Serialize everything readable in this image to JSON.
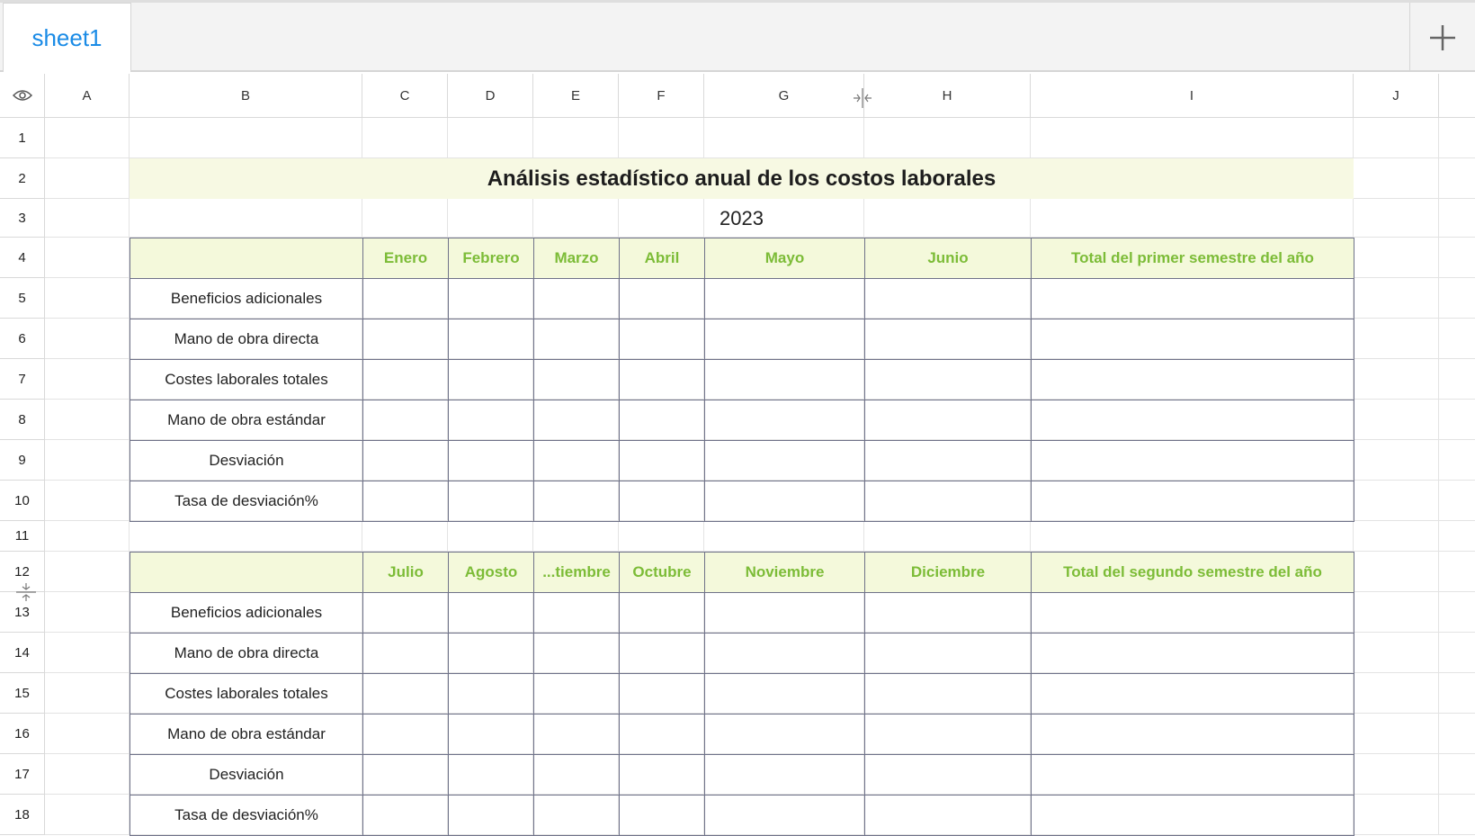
{
  "tabs": [
    {
      "label": "sheet1"
    }
  ],
  "add_tab_icon": "plus-icon",
  "visibility_icon": "eye-icon",
  "columns": [
    "A",
    "B",
    "C",
    "D",
    "E",
    "F",
    "G",
    "H",
    "I",
    "J"
  ],
  "rows": [
    "1",
    "2",
    "3",
    "4",
    "5",
    "6",
    "7",
    "8",
    "9",
    "10",
    "11",
    "12",
    "13",
    "14",
    "15",
    "16",
    "17",
    "18"
  ],
  "sheet": {
    "title": "Análisis estadístico anual de los costos laborales",
    "year": "2023",
    "table1": {
      "headers": [
        "",
        "Enero",
        "Febrero",
        "Marzo",
        "Abril",
        "Mayo",
        "Junio",
        "Total del primer semestre del año"
      ],
      "row_labels": [
        "Beneficios adicionales",
        "Mano de obra directa",
        "Costes laborales totales",
        "Mano de obra estándar",
        "Desviación",
        "Tasa de desviación%"
      ]
    },
    "table2": {
      "headers": [
        "",
        "Julio",
        "Agosto",
        "...tiembre",
        "Octubre",
        "Noviembre",
        "Diciembre",
        "Total del segundo semestre del año"
      ],
      "row_labels": [
        "Beneficios adicionales",
        "Mano de obra directa",
        "Costes laborales totales",
        "Mano de obra estándar",
        "Desviación",
        "Tasa de desviación%"
      ]
    }
  },
  "colors": {
    "tab_text": "#1a8be6",
    "header_text": "#7cbc37",
    "header_fill": "#f4f9db",
    "title_fill": "#f7f9e3",
    "table_border": "#6f7289"
  }
}
